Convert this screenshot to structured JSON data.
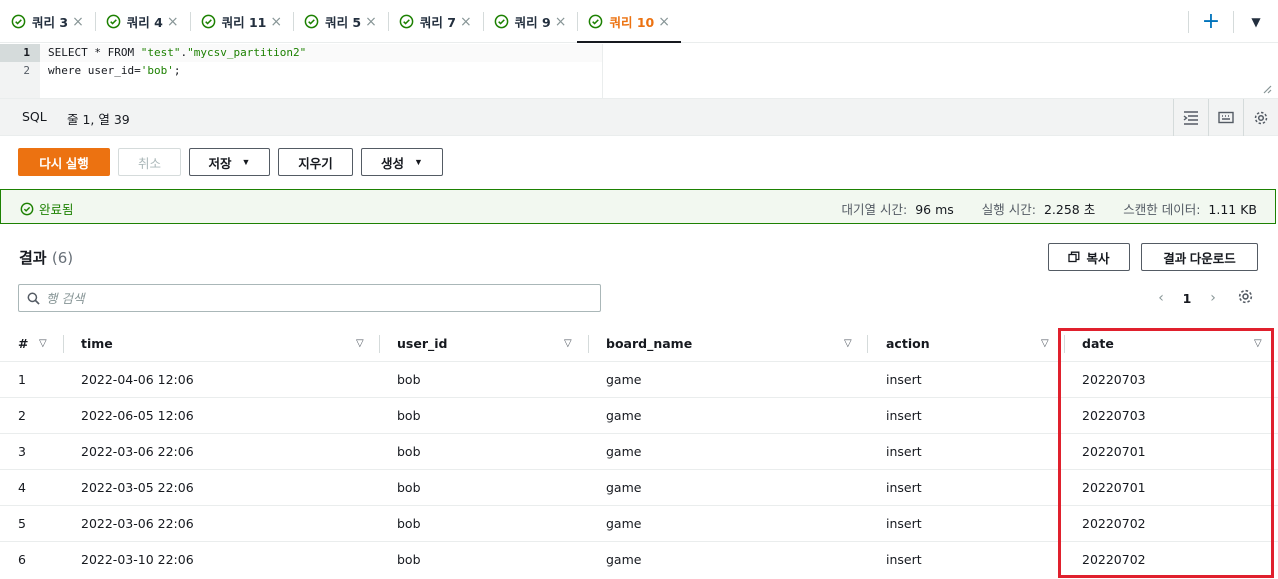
{
  "tabs": [
    {
      "label": "쿼리 3",
      "active": false
    },
    {
      "label": "쿼리 4",
      "active": false
    },
    {
      "label": "쿼리 11",
      "active": false
    },
    {
      "label": "쿼리 5",
      "active": false
    },
    {
      "label": "쿼리 7",
      "active": false
    },
    {
      "label": "쿼리 9",
      "active": false
    },
    {
      "label": "쿼리 10",
      "active": true
    }
  ],
  "tab_close_glyph": "×",
  "tab_add_glyph": "+",
  "tab_menu_glyph": "▼",
  "editor": {
    "line_numbers": [
      "1",
      "2"
    ],
    "line1_prefix": "SELECT * FROM ",
    "line1_str1": "\"test\"",
    "line1_dot": ".",
    "line1_str2": "\"mycsv_partition2\"",
    "line2_prefix": "where user_id=",
    "line2_str": "'bob'",
    "line2_suffix": ";"
  },
  "status": {
    "language": "SQL",
    "cursor": "줄 1, 열 39"
  },
  "actions": {
    "run_again": "다시 실행",
    "cancel": "취소",
    "save": "저장",
    "clear": "지우기",
    "create": "생성"
  },
  "banner": {
    "state": "완료됨",
    "queue_time_label": "대기열 시간:",
    "queue_time_value": "96 ms",
    "run_time_label": "실행 시간:",
    "run_time_value": "2.258 초",
    "scanned_label": "스캔한 데이터:",
    "scanned_value": "1.11 KB"
  },
  "results": {
    "title": "결과",
    "count": "(6)",
    "copy": "복사",
    "download": "결과 다운로드",
    "search_placeholder": "행 검색",
    "page": "1",
    "prev_glyph": "‹",
    "next_glyph": "›"
  },
  "table": {
    "columns": [
      "#",
      "time",
      "user_id",
      "board_name",
      "action",
      "date"
    ],
    "sort_glyph": "▽",
    "rows": [
      [
        "1",
        "2022-04-06 12:06",
        "bob",
        "game",
        "insert",
        "20220703"
      ],
      [
        "2",
        "2022-06-05 12:06",
        "bob",
        "game",
        "insert",
        "20220703"
      ],
      [
        "3",
        "2022-03-06 22:06",
        "bob",
        "game",
        "insert",
        "20220701"
      ],
      [
        "4",
        "2022-03-05 22:06",
        "bob",
        "game",
        "insert",
        "20220701"
      ],
      [
        "5",
        "2022-03-06 22:06",
        "bob",
        "game",
        "insert",
        "20220702"
      ],
      [
        "6",
        "2022-03-10 22:06",
        "bob",
        "game",
        "insert",
        "20220702"
      ]
    ]
  },
  "colors": {
    "accent": "#ec7211",
    "success": "#1d8102",
    "link": "#0073bb",
    "annotation": "#e0202d"
  }
}
